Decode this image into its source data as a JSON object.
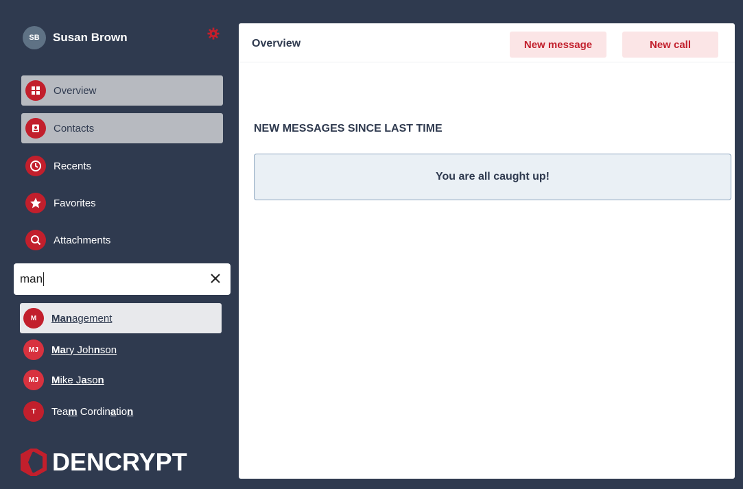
{
  "user": {
    "initials": "SB",
    "name": "Susan Brown"
  },
  "nav": [
    {
      "label": "Overview",
      "icon": "grid-icon",
      "active": true
    },
    {
      "label": "Contacts",
      "icon": "contact-card-icon",
      "active": true
    },
    {
      "label": "Recents",
      "icon": "clock-icon",
      "active": false
    },
    {
      "label": "Favorites",
      "icon": "star-icon",
      "active": false
    },
    {
      "label": "Attachments",
      "icon": "search-icon",
      "active": false
    }
  ],
  "search": {
    "value": "man"
  },
  "results": [
    {
      "initials": "M",
      "name": "Management",
      "highlighted": true
    },
    {
      "initials": "MJ",
      "name": "Mary Johnson",
      "highlighted": false
    },
    {
      "initials": "MJ",
      "name": "Mike Jason",
      "highlighted": false
    },
    {
      "initials": "T",
      "name": "Team Cordination",
      "highlighted": false
    }
  ],
  "logo": {
    "text": "DENCRYPT"
  },
  "main": {
    "title": "Overview",
    "new_message_label": "New message",
    "new_call_label": "New call",
    "section_title": "NEW MESSAGES SINCE LAST TIME",
    "notice": "You are all caught up!"
  },
  "colors": {
    "sidebar_bg": "#2f3a4f",
    "accent_red": "#c21f2c",
    "avatar_user": "#5f7285",
    "avatar_red_light": "#d8323f",
    "button_bg": "#fbe5e6",
    "notice_bg": "#eaf0f5"
  }
}
